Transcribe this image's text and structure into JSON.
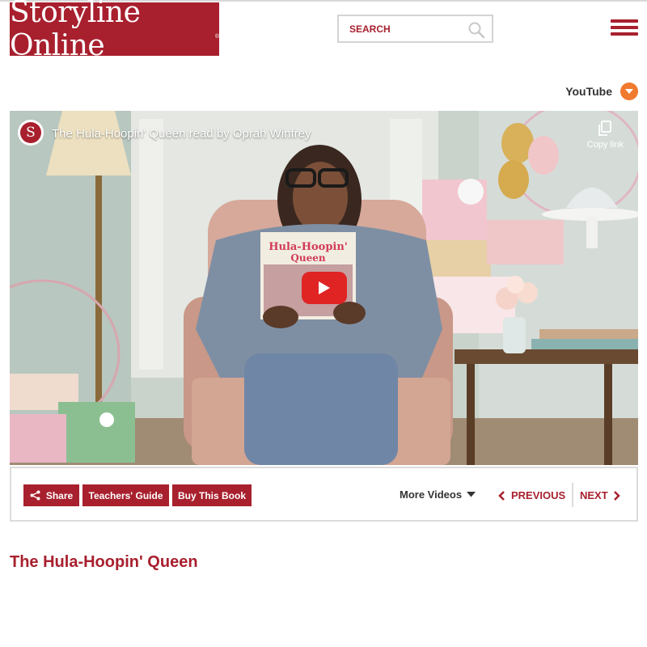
{
  "header": {
    "logo_text": "Storyline Online",
    "logo_mark": "®",
    "search_placeholder": "SEARCH",
    "menu_icon": "hamburger-menu-icon"
  },
  "player_toggle": {
    "label": "YouTube",
    "icon": "chevron-down-icon"
  },
  "video": {
    "channel_icon": "S",
    "title": "The Hula-Hoopin' Queen read by Oprah Winfrey",
    "copy_link_label": "Copy link",
    "play_icon": "play-icon"
  },
  "toolbar": {
    "share_label": "Share",
    "teachers_guide_label": "Teachers' Guide",
    "buy_label": "Buy This Book",
    "more_videos_label": "More Videos",
    "previous_label": "PREVIOUS",
    "next_label": "NEXT"
  },
  "page": {
    "book_title": "The Hula-Hoopin' Queen"
  },
  "colors": {
    "brand": "#a8202e",
    "accent": "#f07a2e",
    "play": "#e02424"
  }
}
